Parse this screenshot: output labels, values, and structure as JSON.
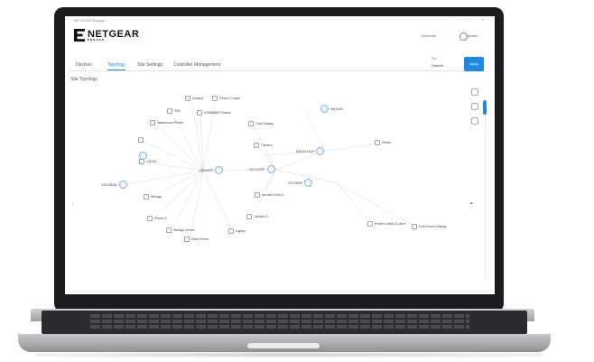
{
  "window": {
    "title": "NETGEAR Engage",
    "controls": "–  □  ×"
  },
  "brand": {
    "name": "NETGEAR",
    "sub": "ENGAGE"
  },
  "header": {
    "account": "Controller",
    "user": "Admin"
  },
  "tabs": [
    {
      "label": "Devices"
    },
    {
      "label": "Topology"
    },
    {
      "label": "Site Settings"
    },
    {
      "label": "Controller Management"
    }
  ],
  "toolbar": {
    "scope_label": "Site",
    "scope_value": "Default",
    "apply_label": "Apply"
  },
  "section": {
    "title": "Site Topology"
  },
  "devices": [
    {
      "label": "Hotspot"
    },
    {
      "label": "Printer-2-Laser"
    },
    {
      "label": "PBX"
    },
    {
      "label": "XS508MBP-Switch"
    },
    {
      "label": "Warehouse-Printer"
    },
    {
      "label": "Conf-Display"
    },
    {
      "label": "Camera"
    },
    {
      "label": "Printer"
    },
    {
      "label": "GS108"
    },
    {
      "label": "Access-Point-6"
    },
    {
      "label": "Storage"
    },
    {
      "label": "Camera-3"
    },
    {
      "label": "Printer-3"
    },
    {
      "label": "Storage-Server"
    },
    {
      "label": "Laptop"
    },
    {
      "label": "Desk-Phone"
    },
    {
      "label": "Printer-Lobby-3-Laser"
    },
    {
      "label": "Conf-Room-Display"
    },
    {
      "label": "Lobby-Kiosk"
    },
    {
      "label": "Thermostat"
    }
  ],
  "hubs": [
    {
      "label": "GS324TP"
    },
    {
      "label": "GS110EMX"
    },
    {
      "label": "GS724TPP"
    },
    {
      "label": "GS108T"
    },
    {
      "label": "WAX630"
    },
    {
      "label": "MS510TXUP"
    },
    {
      "label": "XS724EM"
    },
    {
      "label": "WAX610"
    }
  ],
  "icons": {
    "search": "search-icon",
    "locate": "locate-icon",
    "refresh": "refresh-icon"
  },
  "colors": {
    "accent": "#1e88e5",
    "hub_border": "#7fb3e5"
  }
}
